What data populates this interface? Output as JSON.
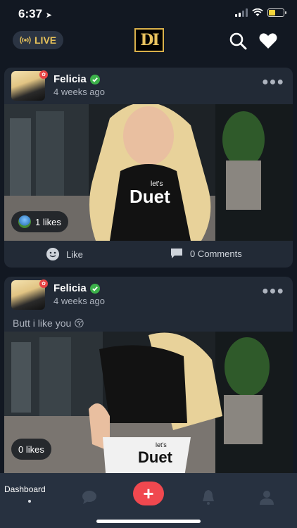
{
  "status_bar": {
    "time": "6:37"
  },
  "header": {
    "live_label": "LIVE",
    "logo_text": "DI"
  },
  "posts": [
    {
      "author": "Felicia",
      "time_ago": "4 weeks ago",
      "likes_label": "1 likes",
      "like_label": "Like",
      "comments_label": "0 Comments"
    },
    {
      "author": "Felicia",
      "time_ago": "4 weeks ago",
      "caption": "Butt i like you 😚",
      "likes_label": "0 likes"
    }
  ],
  "image_text": {
    "shirt_small": "let's",
    "shirt_brand": "Duet"
  },
  "bottom_nav": {
    "dashboard_label": "Dashboard"
  },
  "colors": {
    "background": "#121822",
    "card": "#222a36",
    "nav": "#273140",
    "accent_gold": "#e7c25a",
    "add_button": "#f0484f",
    "verified": "#3cb14a"
  }
}
